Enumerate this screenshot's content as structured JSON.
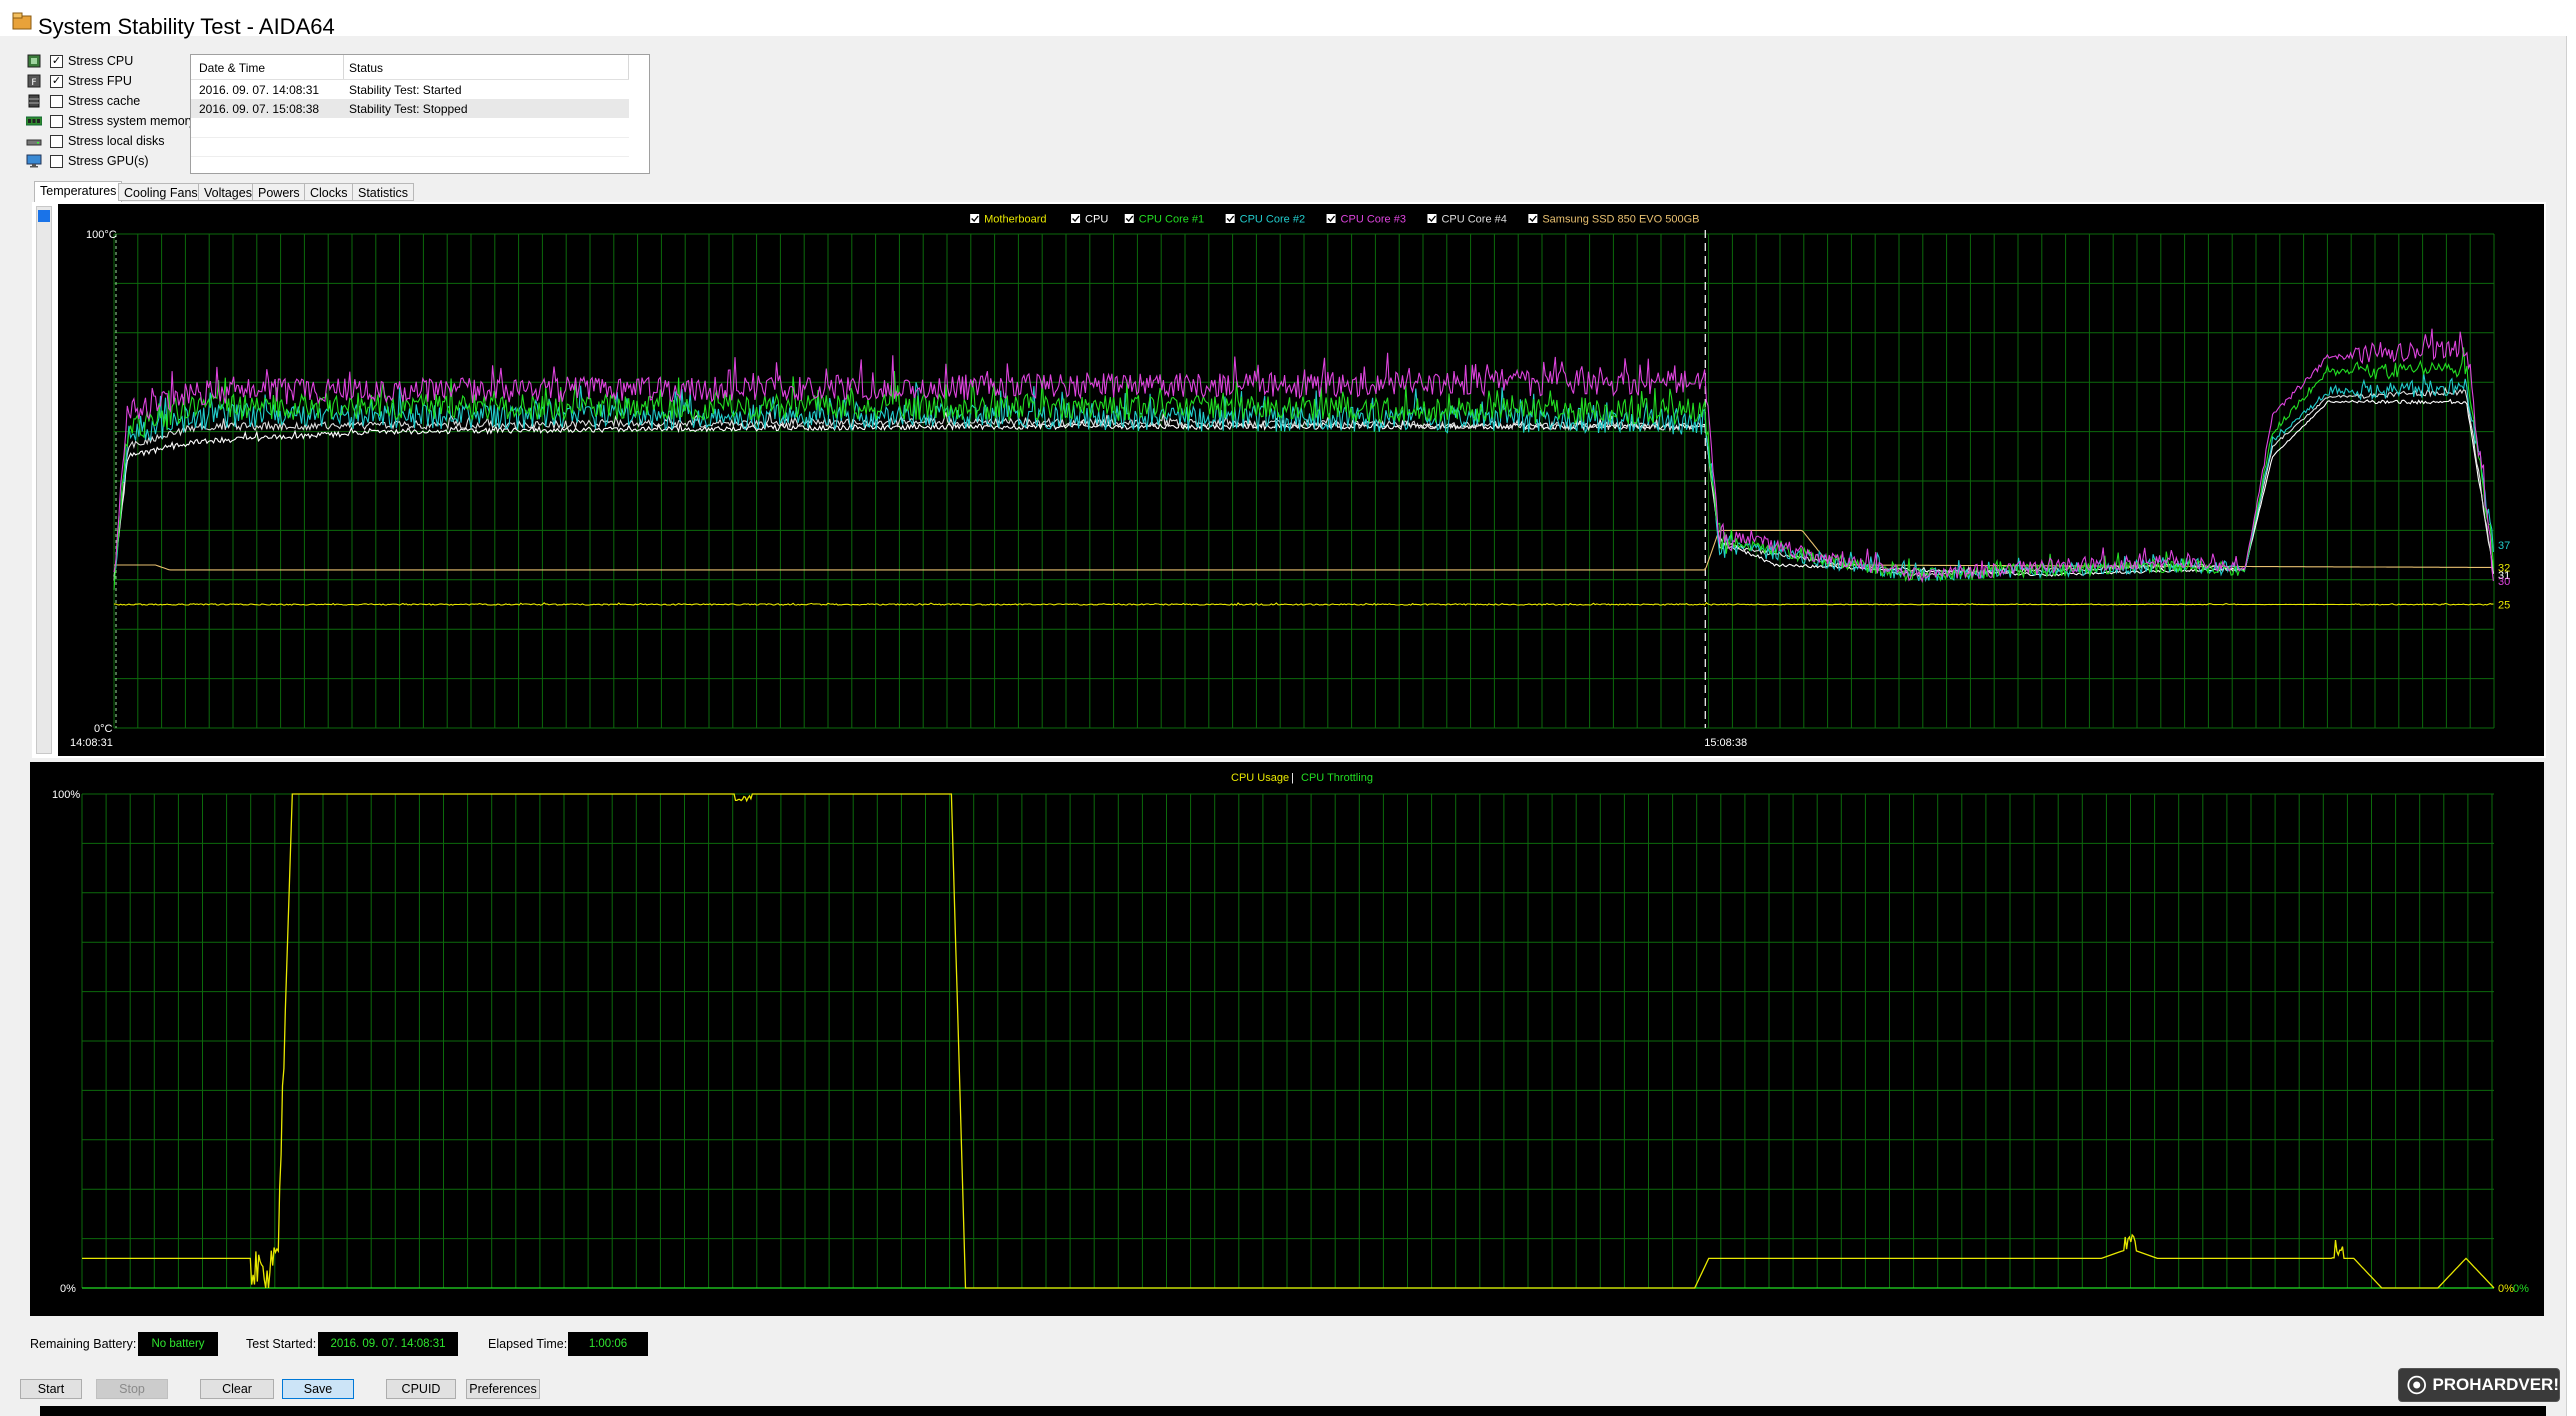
{
  "window": {
    "title": "System Stability Test - AIDA64"
  },
  "stress_options": [
    {
      "label": "Stress CPU",
      "checked": true
    },
    {
      "label": "Stress FPU",
      "checked": true
    },
    {
      "label": "Stress cache",
      "checked": false
    },
    {
      "label": "Stress system memory",
      "checked": false
    },
    {
      "label": "Stress local disks",
      "checked": false
    },
    {
      "label": "Stress GPU(s)",
      "checked": false
    }
  ],
  "log": {
    "columns": [
      "Date & Time",
      "Status"
    ],
    "rows": [
      {
        "datetime": "2016. 09. 07. 14:08:31",
        "status": "Stability Test: Started"
      },
      {
        "datetime": "2016. 09. 07. 15:08:38",
        "status": "Stability Test: Stopped"
      }
    ]
  },
  "tabs": [
    {
      "label": "Temperatures",
      "active": true
    },
    {
      "label": "Cooling Fans",
      "active": false
    },
    {
      "label": "Voltages",
      "active": false
    },
    {
      "label": "Powers",
      "active": false
    },
    {
      "label": "Clocks",
      "active": false
    },
    {
      "label": "Statistics",
      "active": false
    }
  ],
  "temperature_chart": {
    "legend": [
      {
        "label": "Motherboard",
        "color": "#e8e800",
        "checked": true
      },
      {
        "label": "CPU",
        "color": "#ffffff",
        "checked": true
      },
      {
        "label": "CPU Core #1",
        "color": "#22dd22",
        "checked": true
      },
      {
        "label": "CPU Core #2",
        "color": "#22cccc",
        "checked": true
      },
      {
        "label": "CPU Core #3",
        "color": "#dd44dd",
        "checked": true
      },
      {
        "label": "CPU Core #4",
        "color": "#dddddd",
        "checked": true
      },
      {
        "label": "Samsung SSD 850 EVO 500GB",
        "color": "#e8c070",
        "checked": true
      }
    ],
    "y_top_label": "100°C",
    "y_bottom_label": "0°C",
    "x_start_label": "14:08:31",
    "x_marker_label": "15:08:38",
    "end_value_labels": [
      {
        "text": "37",
        "color": "#22cccc",
        "value": 37
      },
      {
        "text": "32",
        "color": "#e8e800",
        "value": 32.5
      },
      {
        "text": "31",
        "color": "#ffffff",
        "value": 31
      },
      {
        "text": "30",
        "color": "#dd44dd",
        "value": 29.8
      },
      {
        "text": "25",
        "color": "#e8e800",
        "value": 25
      }
    ]
  },
  "cpu_chart": {
    "legend": [
      {
        "label": "CPU Usage",
        "color": "#e8e800"
      },
      {
        "label": "CPU Throttling",
        "color": "#22dd22"
      }
    ],
    "separator": "|",
    "y_top_label": "100%",
    "y_bottom_label": "0%",
    "end_labels": [
      {
        "text": "0%",
        "color": "#e8e800"
      },
      {
        "text": "0%",
        "color": "#22dd22"
      }
    ]
  },
  "status": {
    "remaining_battery_label": "Remaining Battery:",
    "remaining_battery_value": "No battery",
    "test_started_label": "Test Started:",
    "test_started_value": "2016. 09. 07. 14:08:31",
    "elapsed_time_label": "Elapsed Time:",
    "elapsed_time_value": "1:00:06"
  },
  "buttons": {
    "start": "Start",
    "stop": "Stop",
    "clear": "Clear",
    "save": "Save",
    "cpuid": "CPUID",
    "preferences": "Preferences"
  },
  "watermark": {
    "text": "PROHARDVER!"
  },
  "chart_data": [
    {
      "type": "line",
      "x_range_minutes": [
        0,
        86
      ],
      "ylim": [
        0,
        100
      ],
      "y_unit": "°C",
      "grid": true,
      "legend_position": "top-center",
      "series": [
        {
          "name": "Motherboard",
          "x": [
            0,
            1.2,
            1.5,
            57.5,
            58,
            84
          ],
          "y": [
            25,
            25,
            25,
            25,
            25,
            25
          ]
        },
        {
          "name": "CPU",
          "x": [
            0,
            0.5,
            3,
            10,
            30,
            57.5,
            58,
            60,
            65,
            70,
            75,
            77,
            78,
            80,
            85,
            86
          ],
          "y": [
            30,
            55,
            58,
            60,
            61,
            61,
            38,
            33,
            32,
            31,
            32,
            32,
            55,
            66,
            66,
            31
          ]
        },
        {
          "name": "CPU Core #1",
          "x": [
            0,
            0.5,
            3,
            30,
            57.5,
            58,
            65,
            75,
            77,
            78,
            80,
            85,
            86
          ],
          "y": [
            30,
            60,
            65,
            65,
            64,
            38,
            31,
            33,
            32,
            60,
            72,
            73,
            32
          ]
        },
        {
          "name": "CPU Core #2",
          "x": [
            0,
            0.5,
            3,
            30,
            57.5,
            58,
            65,
            75,
            77,
            78,
            80,
            85,
            86
          ],
          "y": [
            30,
            59,
            63,
            63,
            62,
            37,
            31,
            33,
            32,
            58,
            68,
            69,
            37
          ]
        },
        {
          "name": "CPU Core #3",
          "x": [
            0,
            0.5,
            3,
            30,
            57.5,
            58,
            65,
            75,
            77,
            78,
            80,
            85,
            86
          ],
          "y": [
            31,
            64,
            68,
            69,
            70,
            39,
            31,
            34,
            32,
            63,
            75,
            77,
            30
          ]
        },
        {
          "name": "CPU Core #4",
          "x": [
            0,
            0.5,
            3,
            30,
            57.5,
            58,
            65,
            75,
            77,
            78,
            80,
            85,
            86
          ],
          "y": [
            30,
            57,
            61,
            62,
            61,
            37,
            31,
            33,
            32,
            57,
            67,
            68,
            31
          ]
        },
        {
          "name": "Samsung SSD 850 EVO 500GB",
          "x": [
            0,
            1.5,
            2,
            57.5,
            58,
            61,
            62,
            86
          ],
          "y": [
            33,
            33,
            32,
            32,
            40,
            40,
            33,
            32.5
          ]
        }
      ]
    },
    {
      "type": "line",
      "x_range_minutes": [
        0,
        86
      ],
      "ylim": [
        0,
        100
      ],
      "y_unit": "%",
      "grid": true,
      "legend_position": "top-center",
      "series": [
        {
          "name": "CPU Usage",
          "x": [
            0,
            6,
            6.6,
            7,
            7.5,
            31,
            31.5,
            57.5,
            58,
            62,
            66,
            72,
            73,
            74,
            81,
            82,
            84,
            85,
            86
          ],
          "y": [
            6,
            6,
            0,
            12,
            100,
            100,
            0,
            0,
            6,
            6,
            6,
            6,
            8,
            6,
            6,
            0,
            0,
            6,
            0
          ]
        },
        {
          "name": "CPU Throttling",
          "x": [
            0,
            86
          ],
          "y": [
            0,
            0
          ]
        }
      ]
    }
  ]
}
